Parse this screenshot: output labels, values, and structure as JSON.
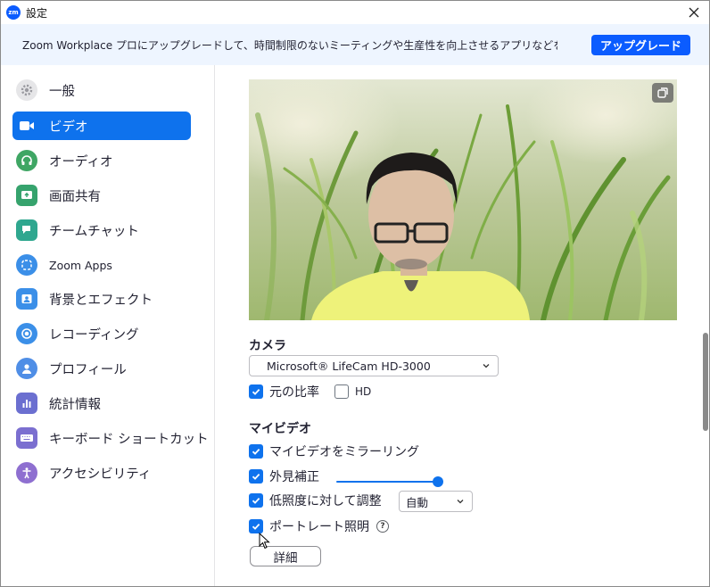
{
  "window": {
    "app_logo_text": "zm",
    "title": "設定"
  },
  "banner": {
    "text": "Zoom Workplace プロにアップグレードして、時間制限のないミーティングや生産性を向上させるアプリなどを活用しまし...",
    "upgrade_label": "アップグレード"
  },
  "sidebar": {
    "items": [
      {
        "label": "一般",
        "icon": "gear-icon",
        "color": "#e8e8ea"
      },
      {
        "label": "ビデオ",
        "icon": "video-camera-icon",
        "color": "#0e72ed",
        "active": true
      },
      {
        "label": "オーディオ",
        "icon": "headphones-icon",
        "color": "#3fa664"
      },
      {
        "label": "画面共有",
        "icon": "share-screen-icon",
        "color": "#36a36d"
      },
      {
        "label": "チームチャット",
        "icon": "chat-icon",
        "color": "#2fa78f"
      },
      {
        "label": "Zoom Apps",
        "icon": "apps-icon",
        "color": "#3b8fe8"
      },
      {
        "label": "背景とエフェクト",
        "icon": "background-icon",
        "color": "#3b8fe8"
      },
      {
        "label": "レコーディング",
        "icon": "record-icon",
        "color": "#3b8fe8"
      },
      {
        "label": "プロフィール",
        "icon": "profile-icon",
        "color": "#4f8ee6"
      },
      {
        "label": "統計情報",
        "icon": "statistics-icon",
        "color": "#6b6fd0"
      },
      {
        "label": "キーボード ショートカット",
        "icon": "keyboard-icon",
        "color": "#7b6fd0"
      },
      {
        "label": "アクセシビリティ",
        "icon": "accessibility-icon",
        "color": "#8e6fd0"
      }
    ]
  },
  "camera": {
    "title": "カメラ",
    "selected": "Microsoft® LifeCam HD-3000",
    "original_ratio_label": "元の比率",
    "original_ratio_checked": true,
    "hd_label": "HD",
    "hd_checked": false
  },
  "my_video": {
    "title": "マイビデオ",
    "mirror_label": "マイビデオをミラーリング",
    "mirror_checked": true,
    "touch_up_label": "外見補正",
    "touch_up_checked": true,
    "touch_up_level": 1.0,
    "low_light_label": "低照度に対して調整",
    "low_light_checked": true,
    "low_light_value": "自動",
    "portrait_label": "ポートレート照明",
    "portrait_checked": true,
    "detail_label": "詳細"
  },
  "colors": {
    "accent": "#0e72ed",
    "brand": "#0b5cff",
    "banner_bg": "#eef5ff"
  }
}
